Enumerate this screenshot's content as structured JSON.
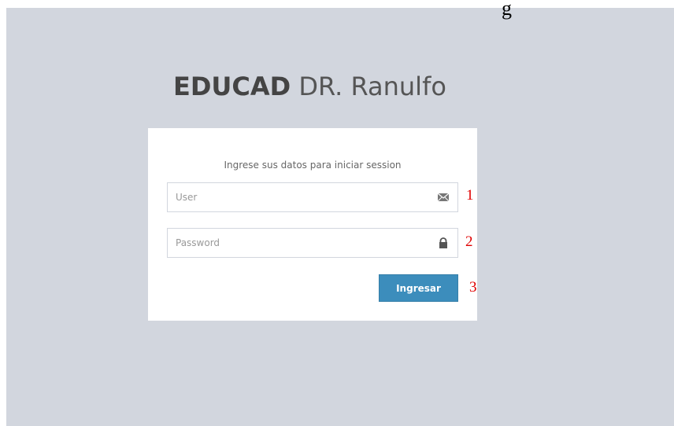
{
  "header": {
    "stray_text": "g"
  },
  "logo": {
    "brand": "EDUCAD",
    "rest": "DR. Ranulfo"
  },
  "login": {
    "message": "Ingrese sus datos para iniciar session",
    "user_placeholder": "User",
    "password_placeholder": "Password",
    "submit_label": "Ingresar",
    "user_icon": "envelope-icon",
    "password_icon": "lock-icon"
  },
  "annotations": [
    "1",
    "2",
    "3"
  ],
  "colors": {
    "background": "#d2d6de",
    "box": "#ffffff",
    "button": "#3c8dbc",
    "annotation": "#e00000"
  }
}
